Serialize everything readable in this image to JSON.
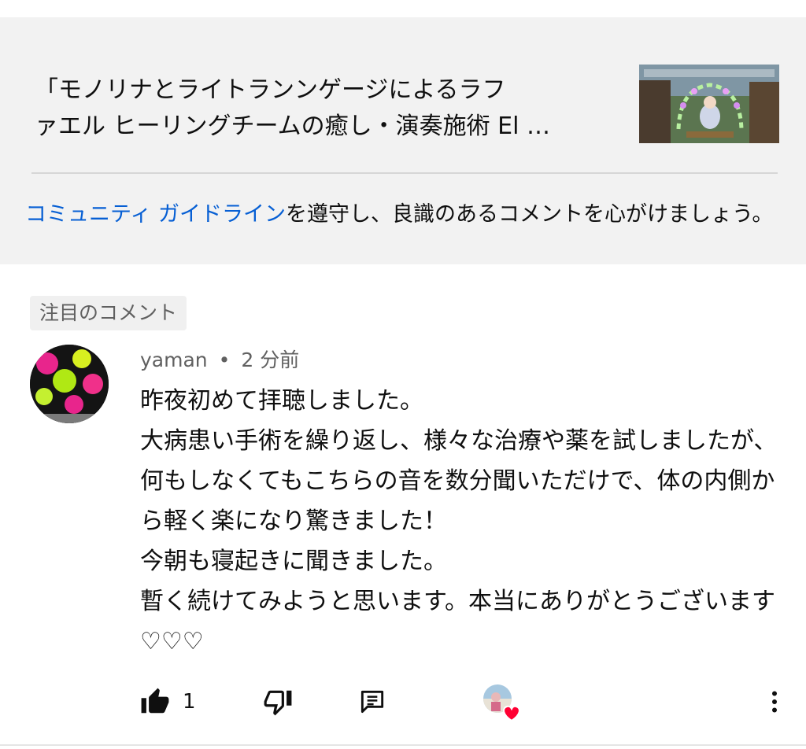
{
  "video": {
    "title": "「モノリナとライトランンゲージによるラフ\nァエル ヒーリングチームの癒し・演奏施術 El …",
    "thumbnail_icon": "video-thumbnail"
  },
  "guideline": {
    "link_text": "コミュニティ ガイドライン",
    "text": "を遵守し、良識のあるコメントを心がけましょう。"
  },
  "comment": {
    "pinned_label": "注目のコメント",
    "author": "yaman",
    "separator": "•",
    "time": "2 分前",
    "body_lines": [
      "昨夜初めて拝聴しました。",
      "大病患い手術を繰り返し、様々な治療や薬を試しましたが、何もしなくてもこちらの音を数分聞いただけで、体の内側から軽く楽になり驚きました！",
      "今朝も寝起きに聞きました。",
      "暫く続けてみようと思います。本当にありがとうございます♡♡♡"
    ],
    "likes": "1"
  },
  "icons": {
    "like": "thumb-up-icon",
    "dislike": "thumb-down-icon",
    "reply": "reply-icon",
    "creator_heart": "heart-icon",
    "more": "more-vert-icon"
  },
  "colors": {
    "link": "#065fd4",
    "heart": "#ff0033",
    "panel_bg": "#f2f2f2"
  }
}
